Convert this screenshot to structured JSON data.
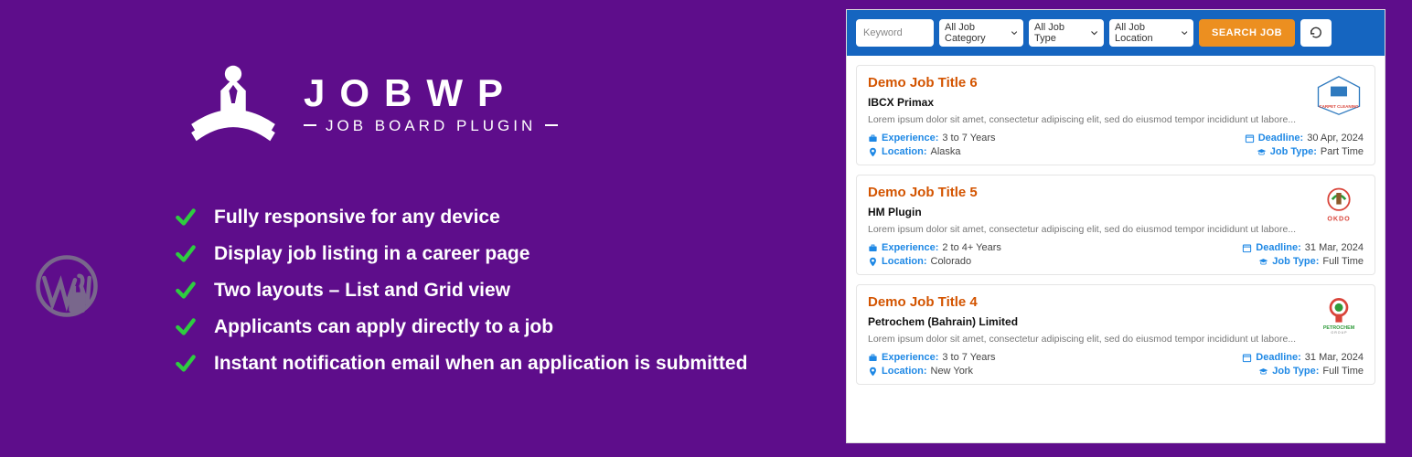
{
  "brand": {
    "title": "JOBWP",
    "subtitle": "JOB BOARD PLUGIN"
  },
  "features": [
    "Fully responsive for any device",
    "Display job listing in a career page",
    "Two layouts – List and Grid view",
    "Applicants can apply directly to a job",
    "Instant notification email when an application is submitted"
  ],
  "search": {
    "keyword_placeholder": "Keyword",
    "category": "All Job Category",
    "jobtype": "All Job Type",
    "location": "All Job Location",
    "button": "SEARCH JOB"
  },
  "labels": {
    "experience": "Experience:",
    "location": "Location:",
    "deadline": "Deadline:",
    "jobtype": "Job Type:"
  },
  "jobs": [
    {
      "title": "Demo Job Title 6",
      "company": "IBCX Primax",
      "desc": "Lorem ipsum dolor sit amet, consectetur adipiscing elit, sed do eiusmod tempor incididunt ut labore...",
      "experience": "3 to 7 Years",
      "location": "Alaska",
      "deadline": "30 Apr, 2024",
      "jobtype": "Part Time",
      "logo_caption": "CARPET CLEANING",
      "logo_color1": "#2f7abf",
      "logo_color2": "#d9443a"
    },
    {
      "title": "Demo Job Title 5",
      "company": "HM Plugin",
      "desc": "Lorem ipsum dolor sit amet, consectetur adipiscing elit, sed do eiusmod tempor incididunt ut labore...",
      "experience": "2 to 4+ Years",
      "location": "Colorado",
      "deadline": "31 Mar, 2024",
      "jobtype": "Full Time",
      "logo_caption": "OKDO",
      "logo_color1": "#2f9b3a",
      "logo_color2": "#d9443a"
    },
    {
      "title": "Demo Job Title 4",
      "company": "Petrochem (Bahrain) Limited",
      "desc": "Lorem ipsum dolor sit amet, consectetur adipiscing elit, sed do eiusmod tempor incididunt ut labore...",
      "experience": "3 to 7 Years",
      "location": "New York",
      "deadline": "31 Mar, 2024",
      "jobtype": "Full Time",
      "logo_caption": "PETROCHEM",
      "logo_color1": "#2f9b3a",
      "logo_color2": "#d9443a"
    }
  ]
}
